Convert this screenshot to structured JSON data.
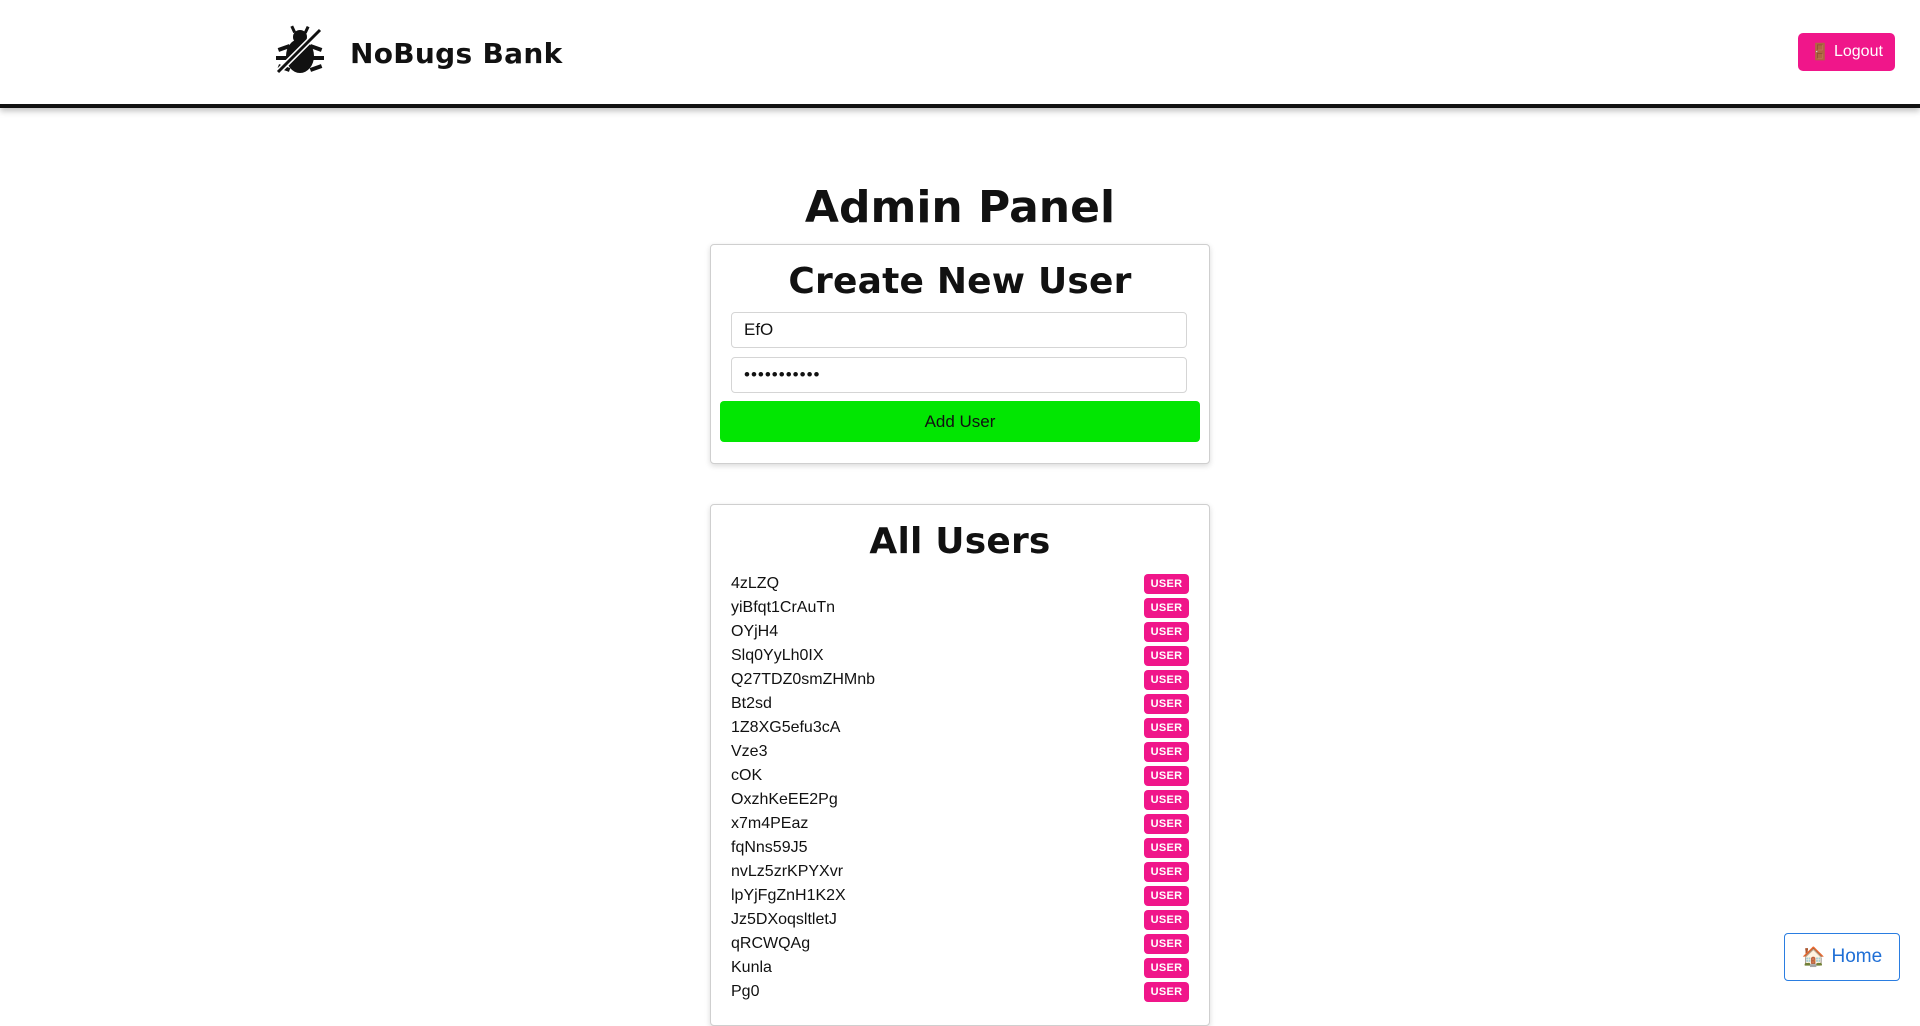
{
  "header": {
    "brand_name": "NoBugs Bank",
    "logo_icon": "bug-icon",
    "logout_icon": "door-icon",
    "logout_label": "Logout"
  },
  "page": {
    "title": "Admin Panel"
  },
  "create_user": {
    "title": "Create New User",
    "username_value": "EfO",
    "password_value": "•••••••••••",
    "add_button_label": "Add User"
  },
  "all_users": {
    "title": "All Users",
    "users": [
      {
        "name": "4zLZQ",
        "role": "USER"
      },
      {
        "name": "yiBfqt1CrAuTn",
        "role": "USER"
      },
      {
        "name": "OYjH4",
        "role": "USER"
      },
      {
        "name": "Slq0YyLh0IX",
        "role": "USER"
      },
      {
        "name": "Q27TDZ0smZHMnb",
        "role": "USER"
      },
      {
        "name": "Bt2sd",
        "role": "USER"
      },
      {
        "name": "1Z8XG5efu3cA",
        "role": "USER"
      },
      {
        "name": "Vze3",
        "role": "USER"
      },
      {
        "name": "cOK",
        "role": "USER"
      },
      {
        "name": "OxzhKeEE2Pg",
        "role": "USER"
      },
      {
        "name": "x7m4PEaz",
        "role": "USER"
      },
      {
        "name": "fqNns59J5",
        "role": "USER"
      },
      {
        "name": "nvLz5zrKPYXvr",
        "role": "USER"
      },
      {
        "name": "lpYjFgZnH1K2X",
        "role": "USER"
      },
      {
        "name": "Jz5DXoqsltletJ",
        "role": "USER"
      },
      {
        "name": "qRCWQAg",
        "role": "USER"
      },
      {
        "name": "Kunla",
        "role": "USER"
      },
      {
        "name": "Pg0",
        "role": "USER"
      }
    ]
  },
  "home": {
    "icon": "house-icon",
    "label": "Home"
  },
  "colors": {
    "accent_pink": "#f0168a",
    "add_green": "#02e602",
    "home_blue": "#1f6fd6"
  }
}
